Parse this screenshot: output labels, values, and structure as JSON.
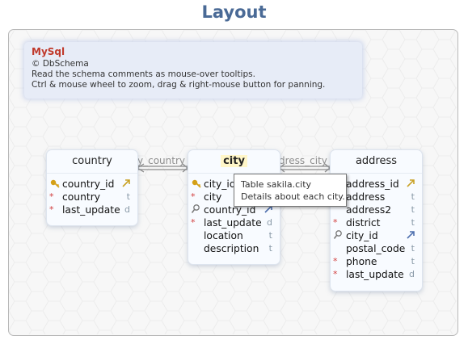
{
  "title": "Layout",
  "note": {
    "brand": "MySql",
    "lines": [
      "© DbSchema",
      "Read the schema comments as mouse-over tooltips.",
      "Ctrl & mouse wheel to zoom, drag & right-mouse button for panning."
    ]
  },
  "tables": {
    "country": {
      "name": "country",
      "columns": [
        {
          "name": "country_id",
          "icon": "primary-key-icon",
          "type": "fk-arrow-icon"
        },
        {
          "name": "country",
          "icon": "not-null-mark",
          "type": "t"
        },
        {
          "name": "last_update",
          "icon": "not-null-mark",
          "type": "d"
        }
      ]
    },
    "city": {
      "name": "city",
      "columns": [
        {
          "name": "city_id",
          "icon": "primary-key-icon",
          "type": ""
        },
        {
          "name": "city",
          "icon": "not-null-mark",
          "type": ""
        },
        {
          "name": "country_id",
          "icon": "foreign-key-search-icon",
          "type": "fk-arrow-icon"
        },
        {
          "name": "last_update",
          "icon": "not-null-mark",
          "type": "d"
        },
        {
          "name": "location",
          "icon": "",
          "type": "t"
        },
        {
          "name": "description",
          "icon": "",
          "type": "t"
        }
      ]
    },
    "address": {
      "name": "address",
      "columns": [
        {
          "name": "address_id",
          "icon": "",
          "type": "fk-arrow-icon"
        },
        {
          "name": "address",
          "icon": "",
          "type": "t"
        },
        {
          "name": "address2",
          "icon": "",
          "type": "t"
        },
        {
          "name": "district",
          "icon": "not-null-mark",
          "type": "t"
        },
        {
          "name": "city_id",
          "icon": "foreign-key-search-icon",
          "type": "fk-arrow-blue-icon"
        },
        {
          "name": "postal_code",
          "icon": "",
          "type": "t"
        },
        {
          "name": "phone",
          "icon": "not-null-mark",
          "type": "t"
        },
        {
          "name": "last_update",
          "icon": "not-null-mark",
          "type": "d"
        }
      ]
    }
  },
  "connections": {
    "city_country": "y_country",
    "address_city": "dress_city"
  },
  "tooltip": {
    "line1": "Table sakila.city",
    "line2": "Details about each city."
  },
  "colors": {
    "title": "#4a6a96",
    "brand": "#c0392b",
    "not_null": "#d24040",
    "primary_key": "#d4a017",
    "fk_arrow_gold": "#c9a227",
    "fk_arrow_blue": "#4e6fae"
  }
}
